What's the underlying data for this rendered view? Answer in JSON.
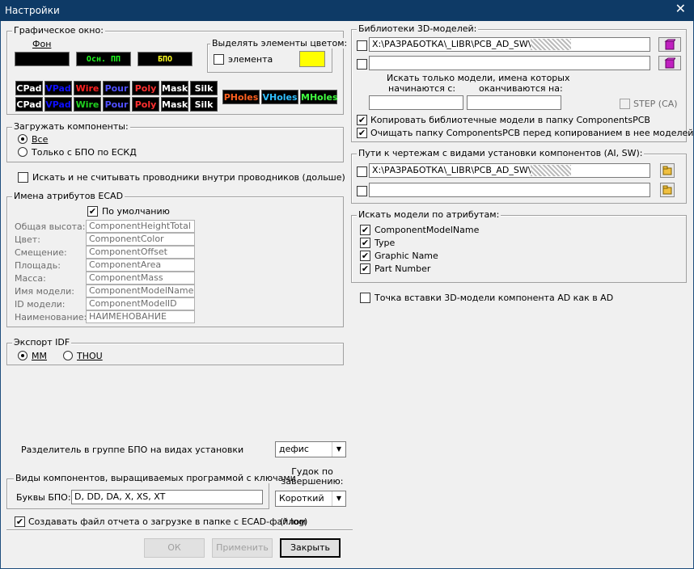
{
  "window": {
    "title": "Настройки"
  },
  "colors": {
    "titlebar": "#0e3a66",
    "highlight_swatch": "#ffff00",
    "chip_bg": "#000000"
  },
  "graphic": {
    "legend": "Графическое окно:",
    "fon_label": "Фон",
    "osn_label": "Осн. ПП",
    "bpo_label": "БПО",
    "highlight_legend": "Выделять элементы цветом:",
    "element_label": "элемента",
    "row1": [
      {
        "t": "CPad",
        "c": "#ffffff"
      },
      {
        "t": "VPad",
        "c": "#1010ff"
      },
      {
        "t": "Wire",
        "c": "#ff2020"
      },
      {
        "t": "Pour",
        "c": "#5050ff"
      },
      {
        "t": "Poly",
        "c": "#ff3030"
      },
      {
        "t": "Mask",
        "c": "#ffffff"
      },
      {
        "t": "Silk",
        "c": "#ffffff"
      }
    ],
    "row2": [
      {
        "t": "CPad",
        "c": "#ffffff"
      },
      {
        "t": "VPad",
        "c": "#1010ff"
      },
      {
        "t": "Wire",
        "c": "#20d020"
      },
      {
        "t": "Pour",
        "c": "#5050ff"
      },
      {
        "t": "Poly",
        "c": "#ff3030"
      },
      {
        "t": "Mask",
        "c": "#ffffff"
      },
      {
        "t": "Silk",
        "c": "#ffffff"
      }
    ],
    "holes": [
      {
        "t": "PHoles",
        "c": "#ff6020"
      },
      {
        "t": "VHoles",
        "c": "#30c0ff"
      },
      {
        "t": "MHoles",
        "c": "#40ff40"
      }
    ]
  },
  "load": {
    "legend": "Загружать компоненты:",
    "opt_all": "Все",
    "opt_bpo": "Только с БПО по ЕСКД"
  },
  "search_wires": "Искать и не считывать проводники внутри проводников (дольше)",
  "ecad": {
    "legend": "Имена атрибутов ECAD",
    "default_label": "По умолчанию",
    "rows": [
      {
        "label": "Общая высота:",
        "value": "ComponentHeightTotal"
      },
      {
        "label": "Цвет:",
        "value": "ComponentColor"
      },
      {
        "label": "Смещение:",
        "value": "ComponentOffset"
      },
      {
        "label": "Площадь:",
        "value": "ComponentArea"
      },
      {
        "label": "Масса:",
        "value": "ComponentMass"
      },
      {
        "label": "Имя модели:",
        "value": "ComponentModelName"
      },
      {
        "label": "ID модели:",
        "value": "ComponentModelID"
      },
      {
        "label": "Наименование:",
        "value": "НАИМЕНОВАНИЕ"
      }
    ]
  },
  "idf": {
    "legend": "Экспорт IDF",
    "mm": "MM",
    "thou": "THOU"
  },
  "separator": {
    "label": "Разделитель в группе БПО на видах установки",
    "value": "дефис"
  },
  "kinds": {
    "legend": "Виды компонентов, выращиваемых программой с ключами",
    "letters_label": "Буквы БПО:",
    "letters_value": "D, DD, DA, X, XS, XT"
  },
  "beep": {
    "label": "Гудок по завершению:",
    "value": "Короткий"
  },
  "report": {
    "label": "Создавать файл отчета о загрузке в папке с ECAD-файлом",
    "ext": "(*.log)"
  },
  "buttons": {
    "ok": "ОК",
    "apply": "Применить",
    "close": "Закрыть"
  },
  "libs": {
    "legend": "Библиотеки 3D-моделей:",
    "path1": "X:\\РАЗРАБОТКА\\_LIBR\\PCB_AD_SW\\",
    "path2": "",
    "search_only": "Искать только модели, имена которых",
    "starts": "начинаются с:",
    "ends": "оканчиваются на:",
    "step": "STEP (CA)",
    "copy": "Копировать библиотечные модели в папку ComponentsPCB",
    "clean": "Очищать папку ComponentsPCB перед копированием в нее моделей"
  },
  "paths": {
    "legend": "Пути к чертежам с видами установки компонентов (AI, SW):",
    "path1": "X:\\РАЗРАБОТКА\\_LIBR\\PCB_AD_SW\\",
    "path2": ""
  },
  "attrs": {
    "legend": "Искать модели по атрибутам:",
    "items": [
      "ComponentModelName",
      "Type",
      "Graphic Name",
      "Part Number"
    ]
  },
  "insert_point": "Точка вставки 3D-модели компонента AD как в AD"
}
